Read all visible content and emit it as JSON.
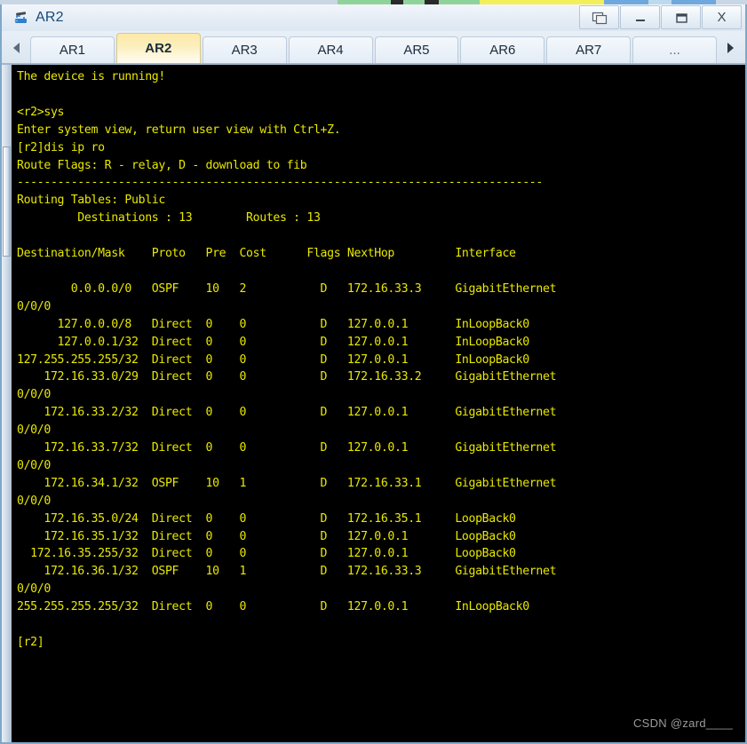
{
  "window": {
    "title": "AR2",
    "app_icon": "router-icon",
    "controls": [
      {
        "name": "restore-windows-button",
        "glyph": "❐",
        "label": "Restore"
      },
      {
        "name": "minimize-button",
        "glyph": "—",
        "label": "Minimize"
      },
      {
        "name": "maximize-button",
        "glyph": "☐",
        "label": "Maximize"
      },
      {
        "name": "close-button",
        "glyph": "X",
        "label": "Close"
      }
    ]
  },
  "tabbar": {
    "scroll_left_label": "◀",
    "scroll_right_label": "▶",
    "active_tab": "AR2",
    "tabs": [
      {
        "label": "AR1",
        "active": false
      },
      {
        "label": "AR2",
        "active": true
      },
      {
        "label": "AR3",
        "active": false
      },
      {
        "label": "AR4",
        "active": false
      },
      {
        "label": "AR5",
        "active": false
      },
      {
        "label": "AR6",
        "active": false
      },
      {
        "label": "AR7",
        "active": false
      },
      {
        "label": "...",
        "active": false
      }
    ]
  },
  "terminal": {
    "foreground_color": "#e8e800",
    "background_color": "#000000",
    "text": "The device is running!\n\n<r2>sys\nEnter system view, return user view with Ctrl+Z.\n[r2]dis ip ro\nRoute Flags: R - relay, D - download to fib\n------------------------------------------------------------------------------\nRouting Tables: Public\n         Destinations : 13        Routes : 13\n\nDestination/Mask    Proto   Pre  Cost      Flags NextHop         Interface\n\n        0.0.0.0/0   OSPF    10   2           D   172.16.33.3     GigabitEthernet\n0/0/0\n      127.0.0.0/8   Direct  0    0           D   127.0.0.1       InLoopBack0\n      127.0.0.1/32  Direct  0    0           D   127.0.0.1       InLoopBack0\n127.255.255.255/32  Direct  0    0           D   127.0.0.1       InLoopBack0\n    172.16.33.0/29  Direct  0    0           D   172.16.33.2     GigabitEthernet\n0/0/0\n    172.16.33.2/32  Direct  0    0           D   127.0.0.1       GigabitEthernet\n0/0/0\n    172.16.33.7/32  Direct  0    0           D   127.0.0.1       GigabitEthernet\n0/0/0\n    172.16.34.1/32  OSPF    10   1           D   172.16.33.1     GigabitEthernet\n0/0/0\n    172.16.35.0/24  Direct  0    0           D   172.16.35.1     LoopBack0\n    172.16.35.1/32  Direct  0    0           D   127.0.0.1       LoopBack0\n  172.16.35.255/32  Direct  0    0           D   127.0.0.1       LoopBack0\n    172.16.36.1/32  OSPF    10   1           D   172.16.33.3     GigabitEthernet\n0/0/0\n255.255.255.255/32  Direct  0    0           D   127.0.0.1       InLoopBack0\n\n[r2]",
    "watermark": "CSDN @zard____"
  },
  "routing_table": {
    "prompt_command": "dis ip ro",
    "route_flags": "R - relay, D - download to fib",
    "table_name": "Public",
    "destinations": 13,
    "routes": 13,
    "columns": [
      "Destination/Mask",
      "Proto",
      "Pre",
      "Cost",
      "Flags",
      "NextHop",
      "Interface"
    ],
    "rows": [
      {
        "destination": "0.0.0.0/0",
        "proto": "OSPF",
        "pre": "10",
        "cost": "2",
        "flags": "D",
        "nexthop": "172.16.33.3",
        "interface": "GigabitEthernet0/0/0"
      },
      {
        "destination": "127.0.0.0/8",
        "proto": "Direct",
        "pre": "0",
        "cost": "0",
        "flags": "D",
        "nexthop": "127.0.0.1",
        "interface": "InLoopBack0"
      },
      {
        "destination": "127.0.0.1/32",
        "proto": "Direct",
        "pre": "0",
        "cost": "0",
        "flags": "D",
        "nexthop": "127.0.0.1",
        "interface": "InLoopBack0"
      },
      {
        "destination": "127.255.255.255/32",
        "proto": "Direct",
        "pre": "0",
        "cost": "0",
        "flags": "D",
        "nexthop": "127.0.0.1",
        "interface": "InLoopBack0"
      },
      {
        "destination": "172.16.33.0/29",
        "proto": "Direct",
        "pre": "0",
        "cost": "0",
        "flags": "D",
        "nexthop": "172.16.33.2",
        "interface": "GigabitEthernet0/0/0"
      },
      {
        "destination": "172.16.33.2/32",
        "proto": "Direct",
        "pre": "0",
        "cost": "0",
        "flags": "D",
        "nexthop": "127.0.0.1",
        "interface": "GigabitEthernet0/0/0"
      },
      {
        "destination": "172.16.33.7/32",
        "proto": "Direct",
        "pre": "0",
        "cost": "0",
        "flags": "D",
        "nexthop": "127.0.0.1",
        "interface": "GigabitEthernet0/0/0"
      },
      {
        "destination": "172.16.34.1/32",
        "proto": "OSPF",
        "pre": "10",
        "cost": "1",
        "flags": "D",
        "nexthop": "172.16.33.1",
        "interface": "GigabitEthernet0/0/0"
      },
      {
        "destination": "172.16.35.0/24",
        "proto": "Direct",
        "pre": "0",
        "cost": "0",
        "flags": "D",
        "nexthop": "172.16.35.1",
        "interface": "LoopBack0"
      },
      {
        "destination": "172.16.35.1/32",
        "proto": "Direct",
        "pre": "0",
        "cost": "0",
        "flags": "D",
        "nexthop": "127.0.0.1",
        "interface": "LoopBack0"
      },
      {
        "destination": "172.16.35.255/32",
        "proto": "Direct",
        "pre": "0",
        "cost": "0",
        "flags": "D",
        "nexthop": "127.0.0.1",
        "interface": "LoopBack0"
      },
      {
        "destination": "172.16.36.1/32",
        "proto": "OSPF",
        "pre": "10",
        "cost": "1",
        "flags": "D",
        "nexthop": "172.16.33.3",
        "interface": "GigabitEthernet0/0/0"
      },
      {
        "destination": "255.255.255.255/32",
        "proto": "Direct",
        "pre": "0",
        "cost": "0",
        "flags": "D",
        "nexthop": "127.0.0.1",
        "interface": "InLoopBack0"
      }
    ]
  }
}
